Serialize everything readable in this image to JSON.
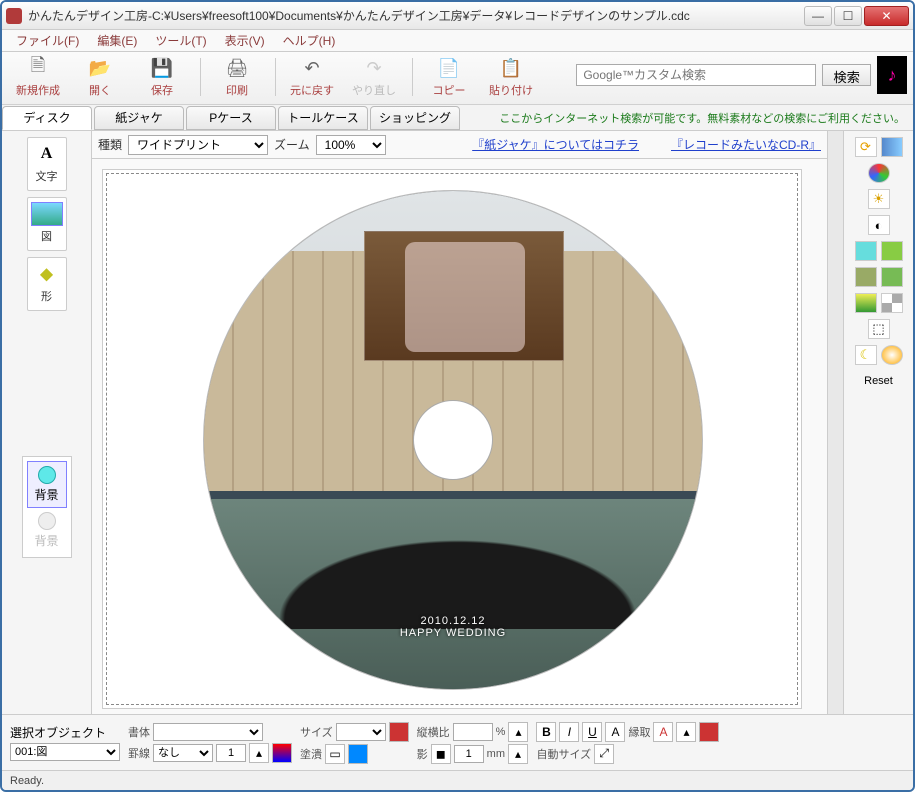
{
  "window": {
    "title": "かんたんデザイン工房-C:¥Users¥freesoft100¥Documents¥かんたんデザイン工房¥データ¥レコードデザインのサンプル.cdc"
  },
  "menu": {
    "file": "ファイル(F)",
    "edit": "編集(E)",
    "tool": "ツール(T)",
    "view": "表示(V)",
    "help": "ヘルプ(H)"
  },
  "toolbar": {
    "new": "新規作成",
    "open": "開く",
    "save": "保存",
    "print": "印刷",
    "undo": "元に戻す",
    "redo": "やり直し",
    "copy": "コピー",
    "paste": "貼り付け",
    "search_placeholder": "Google™カスタム検索",
    "search_btn": "検索"
  },
  "tabs": {
    "items": [
      "ディスク",
      "紙ジャケ",
      "Pケース",
      "トールケース",
      "ショッピング"
    ],
    "hint": "ここからインターネット検索が可能です。無料素材などの検索にご利用ください。"
  },
  "options": {
    "type_label": "種類",
    "type_value": "ワイドプリント",
    "zoom_label": "ズーム",
    "zoom_value": "100%",
    "link1": "『紙ジャケ』についてはコチラ",
    "link2": "『レコードみたいなCD-R』"
  },
  "left_tools": {
    "text": "文字",
    "image": "図",
    "shape": "形",
    "bg_on": "背景",
    "bg_off": "背景"
  },
  "disc": {
    "date": "2010.12.12",
    "caption": "HAPPY WEDDING"
  },
  "right_tools": {
    "reset": "Reset"
  },
  "propbar": {
    "sel_label": "選択オブジェクト",
    "sel_value": "001:図",
    "font_label": "書体",
    "line_label": "罫線",
    "line_value": "なし",
    "line_width": "1",
    "size_label": "サイズ",
    "fill_label": "塗潰",
    "aspect_label": "縦横比",
    "aspect_pct": "%",
    "shadow_label": "影",
    "shadow_val": "1",
    "shadow_unit": "mm",
    "b": "B",
    "i": "I",
    "u": "U",
    "a": "A",
    "stroke_label": "縁取",
    "auto_label": "自動サイズ"
  },
  "status": {
    "text": "Ready."
  }
}
